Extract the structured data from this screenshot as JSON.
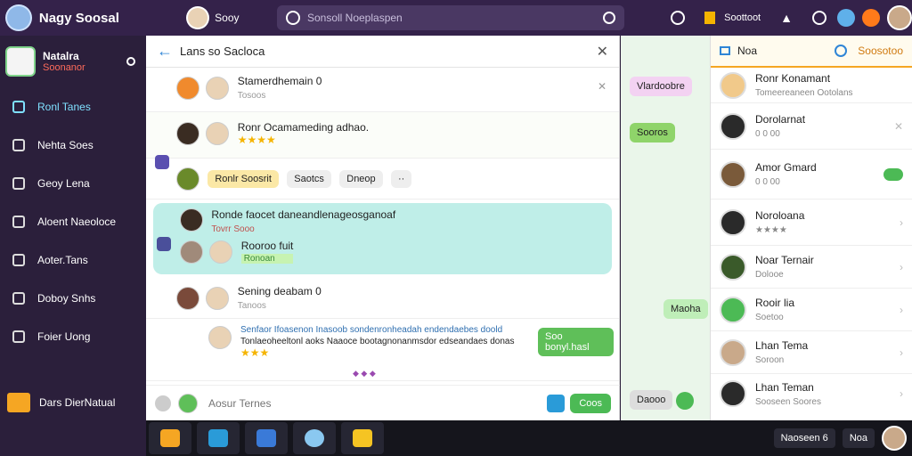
{
  "topbar": {
    "app_title": "Nagy Soosal",
    "user_name": "Sooy",
    "search_placeholder": "Sonsoll Noeplaspen",
    "tray_label": "Soottoot"
  },
  "sidebar": {
    "me": {
      "name": "Natalra",
      "status": "Soonanor"
    },
    "items": [
      {
        "label": "Ronl Tanes"
      },
      {
        "label": "Nehta Soes"
      },
      {
        "label": "Geoy Lena"
      },
      {
        "label": "Aloent Naeoloce"
      },
      {
        "label": "Aoter.Tans"
      },
      {
        "label": "Doboy Snhs"
      },
      {
        "label": "Foier Uong"
      }
    ],
    "footer_label": "Dars DierNatual"
  },
  "main": {
    "title": "Lans so Sacloca",
    "posts": [
      {
        "name": "Stamerdhemain 0",
        "sub": "Tosoos"
      },
      {
        "name": "Ronr Ocamameding adhao.",
        "stars": "★★★★"
      },
      {
        "chips": [
          "Ronlr Soosrit",
          "Saotcs",
          "Dneop",
          "··"
        ]
      },
      {
        "name": "Ronde faocet daneandlenageosganoaf",
        "sub": "Tovrr Sooo",
        "name2": "Rooroo fuit",
        "status2": "Ronoan"
      },
      {
        "name": "Sening deabam 0",
        "sub": "Tanoos"
      },
      {
        "line1": "Senfaor Ifoasenon  Inasoob  sondenronheadah endendaebes  doold",
        "line2": "Tonlaeoheeltonl aoks  Naaoce  bootagnonanmsdor edseandaes donas",
        "stars": "★★★",
        "action": "Soo bonyl.hasl",
        "reactions": "◆ ◆ ◆"
      }
    ],
    "composer_placeholder": "Aosur Ternes",
    "send_label": "Coos"
  },
  "strip": {
    "pills": [
      "Vlardoobre",
      "Sooros",
      "Maoha",
      "Daooo"
    ]
  },
  "right": {
    "head": {
      "tab1": "Noa",
      "tab2": "Soosotoo"
    },
    "people": [
      {
        "name": "Ronr Konamant",
        "sub": "Tomeereaneen Ootolans"
      },
      {
        "name": "Dorolarnat",
        "sub": "0 0 00"
      },
      {
        "name": "Amor Gmard",
        "sub": "0 0 00"
      },
      {
        "name": "Noroloana",
        "sub": "★★★★"
      },
      {
        "name": "Noar Ternair",
        "sub": "Dolooe"
      },
      {
        "name": "Rooir lia",
        "sub": "Soetoo"
      },
      {
        "name": "Lhan Tema",
        "sub": "Soroon"
      },
      {
        "name": "Lhan Teman",
        "sub": "Sooseen Soores"
      }
    ]
  },
  "taskbar": {
    "tray1": "Naoseen 6",
    "tray2": "Noa"
  },
  "colors": {
    "accent": "#5fbf59",
    "topbar": "#34224a",
    "sidebar": "#2b1f3b",
    "orange": "#f5a623"
  }
}
